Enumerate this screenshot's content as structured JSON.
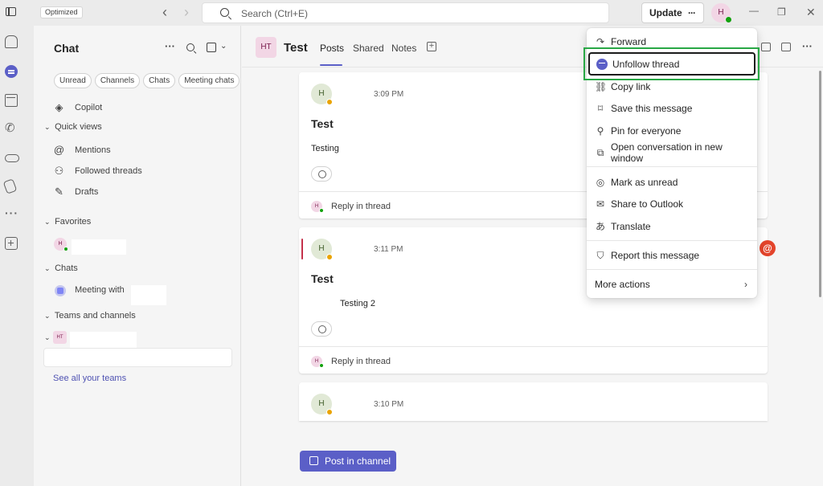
{
  "titlebar": {
    "badge": "Optimized",
    "search_placeholder": "Search (Ctrl+E)",
    "update_label": "Update",
    "update_more": "···",
    "avatar_initial": "H"
  },
  "chatpane": {
    "title": "Chat",
    "more": "···",
    "filters": [
      "Unread",
      "Channels",
      "Chats",
      "Meeting chats"
    ],
    "copilot": "Copilot",
    "quick_views_label": "Quick views",
    "quick_views": [
      "Mentions",
      "Followed threads",
      "Drafts"
    ],
    "favorites_label": "Favorites",
    "favorites_avatar": "H",
    "chats_label": "Chats",
    "chat_item": "Meeting with",
    "teams_label": "Teams and channels",
    "team_avatar": "HT",
    "see_all": "See all your teams"
  },
  "channel": {
    "avatar": "HT",
    "title": "Test",
    "tabs": [
      "Posts",
      "Shared",
      "Notes"
    ]
  },
  "posts": [
    {
      "avatar": "H",
      "time": "3:09 PM",
      "subject": "Test",
      "body": "Testing",
      "reply": "Reply in thread",
      "reply_avatar": "H"
    },
    {
      "avatar": "H",
      "time": "3:11 PM",
      "subject": "Test",
      "body": "Testing 2",
      "reply": "Reply in thread",
      "reply_avatar": "H"
    },
    {
      "avatar": "H",
      "time": "3:10 PM"
    }
  ],
  "post_button": "Post in channel",
  "mention_badge": "@",
  "context_menu": {
    "items": [
      {
        "label": "Forward",
        "icon": "forward-icon"
      },
      {
        "label": "Unfollow thread",
        "icon": "unfollow-icon",
        "selected": true
      },
      {
        "label": "Copy link",
        "icon": "link-icon"
      },
      {
        "label": "Save this message",
        "icon": "bookmark-icon"
      },
      {
        "label": "Pin for everyone",
        "icon": "pin-icon"
      },
      {
        "label": "Open conversation in new window",
        "icon": "popout-icon"
      },
      {
        "label": "Mark as unread",
        "icon": "unread-icon"
      },
      {
        "label": "Share to Outlook",
        "icon": "mail-icon"
      },
      {
        "label": "Translate",
        "icon": "translate-icon"
      },
      {
        "label": "Report this message",
        "icon": "shield-icon"
      },
      {
        "label": "More actions",
        "icon": "chevron-right-icon"
      }
    ]
  },
  "colors": {
    "accent": "#5b5fc7",
    "highlight": "#28a745",
    "mention": "#e3442b",
    "presence_available": "#13a10e",
    "presence_away": "#eaa300"
  }
}
